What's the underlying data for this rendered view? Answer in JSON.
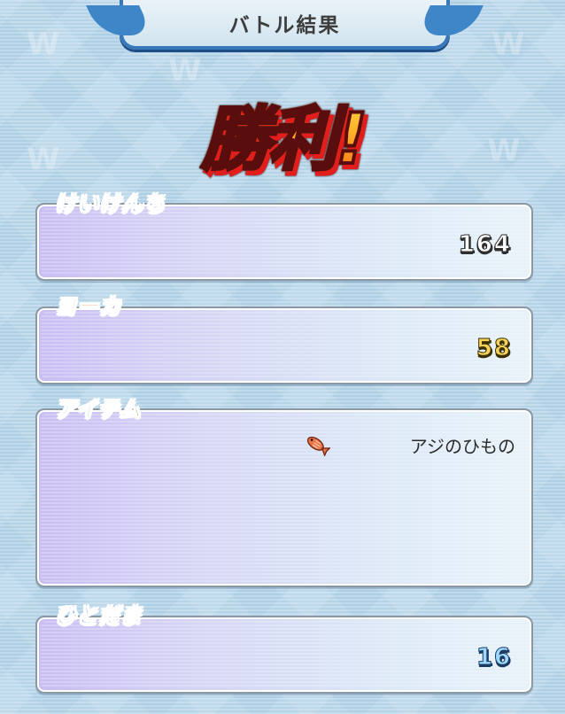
{
  "header": {
    "title": "バトル結果"
  },
  "result": {
    "text": "勝利!"
  },
  "sections": {
    "exp": {
      "label": "けいけんち",
      "value": "164"
    },
    "money": {
      "label": "ヨーカ",
      "value": "58"
    },
    "items": {
      "label": "アイテム",
      "list": [
        {
          "icon": "fish-icon",
          "name": "アジのひもの"
        }
      ]
    },
    "soul": {
      "label": "ひとだま",
      "value": "16"
    }
  },
  "colors": {
    "background": "#b9d7ea",
    "banner_border": "#3a79b9",
    "victory_fill": "#ff8a1a",
    "victory_shadow": "#e31c1c",
    "label_exp": "#2479d0",
    "label_money": "#f05b10",
    "label_items": "#2aa33a",
    "label_soul": "#2479d0"
  }
}
